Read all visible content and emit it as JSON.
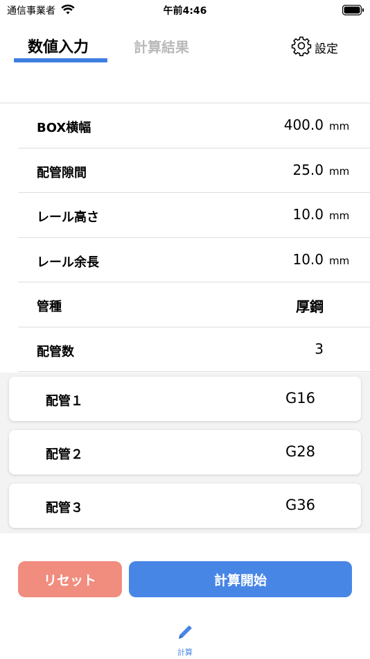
{
  "status_bar": {
    "carrier": "通信事業者",
    "time": "午前4:46"
  },
  "tabs": {
    "input": "数値入力",
    "result": "計算結果"
  },
  "settings": {
    "label": "設定"
  },
  "form": {
    "rows": [
      {
        "label": "BOX横幅",
        "value": "400.0",
        "unit": "mm"
      },
      {
        "label": "配管隙間",
        "value": "25.0",
        "unit": "mm"
      },
      {
        "label": "レール高さ",
        "value": "10.0",
        "unit": "mm"
      },
      {
        "label": "レール余長",
        "value": "10.0",
        "unit": "mm"
      },
      {
        "label": "管種",
        "value": "厚鋼",
        "unit": ""
      },
      {
        "label": "配管数",
        "value": "3",
        "unit": ""
      }
    ]
  },
  "pipes": [
    {
      "label": "配管１",
      "value": "G16"
    },
    {
      "label": "配管２",
      "value": "G28"
    },
    {
      "label": "配管３",
      "value": "G36"
    }
  ],
  "buttons": {
    "reset": "リセット",
    "start": "計算開始"
  },
  "tabbar": {
    "calc": "計算"
  },
  "colors": {
    "accent": "#4886e6",
    "reset": "#f08d7f",
    "tab_underline": "#3e7fe1"
  }
}
